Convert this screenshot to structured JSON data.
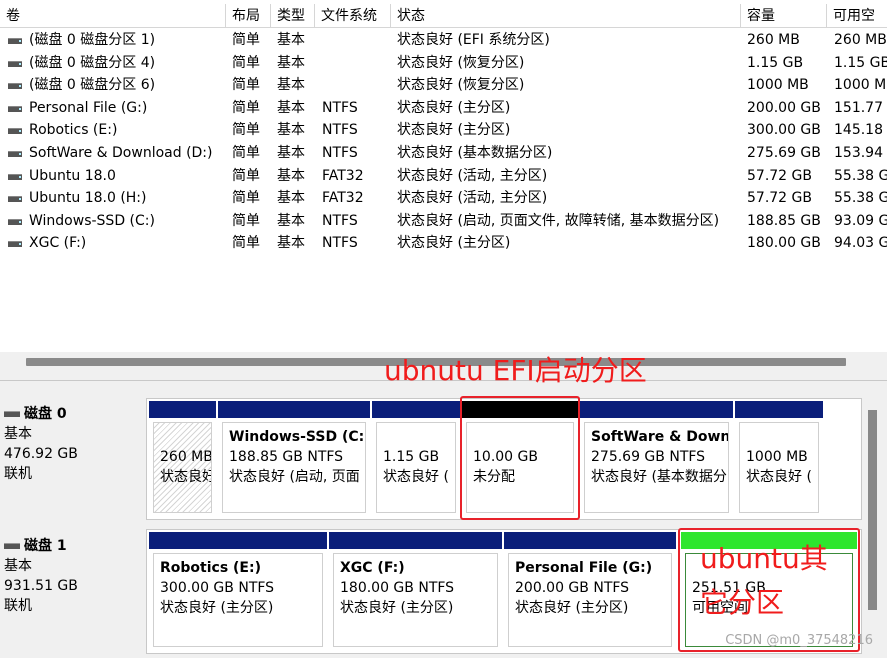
{
  "columns": [
    "卷",
    "布局",
    "类型",
    "文件系统",
    "状态",
    "容量",
    "可用空"
  ],
  "volumes": [
    {
      "name": "(磁盘 0 磁盘分区 1)",
      "layout": "简单",
      "type": "基本",
      "fs": "",
      "status": "状态良好 (EFI 系统分区)",
      "capacity": "260 MB",
      "free": "260 MB"
    },
    {
      "name": "(磁盘 0 磁盘分区 4)",
      "layout": "简单",
      "type": "基本",
      "fs": "",
      "status": "状态良好 (恢复分区)",
      "capacity": "1.15 GB",
      "free": "1.15 GB"
    },
    {
      "name": "(磁盘 0 磁盘分区 6)",
      "layout": "简单",
      "type": "基本",
      "fs": "",
      "status": "状态良好 (恢复分区)",
      "capacity": "1000 MB",
      "free": "1000 MB"
    },
    {
      "name": "Personal File (G:)",
      "layout": "简单",
      "type": "基本",
      "fs": "NTFS",
      "status": "状态良好 (主分区)",
      "capacity": "200.00 GB",
      "free": "151.77"
    },
    {
      "name": "Robotics (E:)",
      "layout": "简单",
      "type": "基本",
      "fs": "NTFS",
      "status": "状态良好 (主分区)",
      "capacity": "300.00 GB",
      "free": "145.18"
    },
    {
      "name": "SoftWare & Download (D:)",
      "layout": "简单",
      "type": "基本",
      "fs": "NTFS",
      "status": "状态良好 (基本数据分区)",
      "capacity": "275.69 GB",
      "free": "153.94"
    },
    {
      "name": "Ubuntu 18.0",
      "layout": "简单",
      "type": "基本",
      "fs": "FAT32",
      "status": "状态良好 (活动, 主分区)",
      "capacity": "57.72 GB",
      "free": "55.38 G"
    },
    {
      "name": "Ubuntu 18.0 (H:)",
      "layout": "简单",
      "type": "基本",
      "fs": "FAT32",
      "status": "状态良好 (活动, 主分区)",
      "capacity": "57.72 GB",
      "free": "55.38 G"
    },
    {
      "name": "Windows-SSD (C:)",
      "layout": "简单",
      "type": "基本",
      "fs": "NTFS",
      "status": "状态良好 (启动, 页面文件, 故障转储, 基本数据分区)",
      "capacity": "188.85 GB",
      "free": "93.09 G"
    },
    {
      "name": "XGC (F:)",
      "layout": "简单",
      "type": "基本",
      "fs": "NTFS",
      "status": "状态良好 (主分区)",
      "capacity": "180.00 GB",
      "free": "94.03 G"
    }
  ],
  "disk0": {
    "name": "磁盘 0",
    "type": "基本",
    "size": "476.92 GB",
    "state": "联机",
    "partitions": [
      {
        "title": "",
        "line1": "260 MB",
        "line2": "状态良好"
      },
      {
        "title": "Windows-SSD  (C:",
        "line1": "188.85 GB NTFS",
        "line2": "状态良好 (启动, 页面"
      },
      {
        "title": "",
        "line1": "1.15 GB",
        "line2": "状态良好 ("
      },
      {
        "title": "",
        "line1": "10.00 GB",
        "line2": "未分配"
      },
      {
        "title": "SoftWare & Down",
        "line1": "275.69 GB NTFS",
        "line2": "状态良好 (基本数据分"
      },
      {
        "title": "",
        "line1": "1000 MB",
        "line2": "状态良好 ("
      }
    ]
  },
  "disk1": {
    "name": "磁盘 1",
    "type": "基本",
    "size": "931.51 GB",
    "state": "联机",
    "partitions": [
      {
        "title": "Robotics  (E:)",
        "line1": "300.00 GB NTFS",
        "line2": "状态良好 (主分区)"
      },
      {
        "title": "XGC  (F:)",
        "line1": "180.00 GB NTFS",
        "line2": "状态良好 (主分区)"
      },
      {
        "title": "Personal File  (G:)",
        "line1": "200.00 GB NTFS",
        "line2": "状态良好 (主分区)"
      },
      {
        "title": "",
        "line1": "251.51 GB",
        "line2": "可用空间"
      }
    ]
  },
  "annotations": {
    "efi": "ubnutu EFI启动分区",
    "other_line1": "ubuntu其",
    "other_line2": "它分区"
  },
  "watermark": "CSDN @m0_37548216",
  "colors": {
    "primary_bar": "#0a1e7a",
    "unallocated_bar": "#000000",
    "free_bar": "#2ee62e",
    "annotation": "#e8222b"
  }
}
